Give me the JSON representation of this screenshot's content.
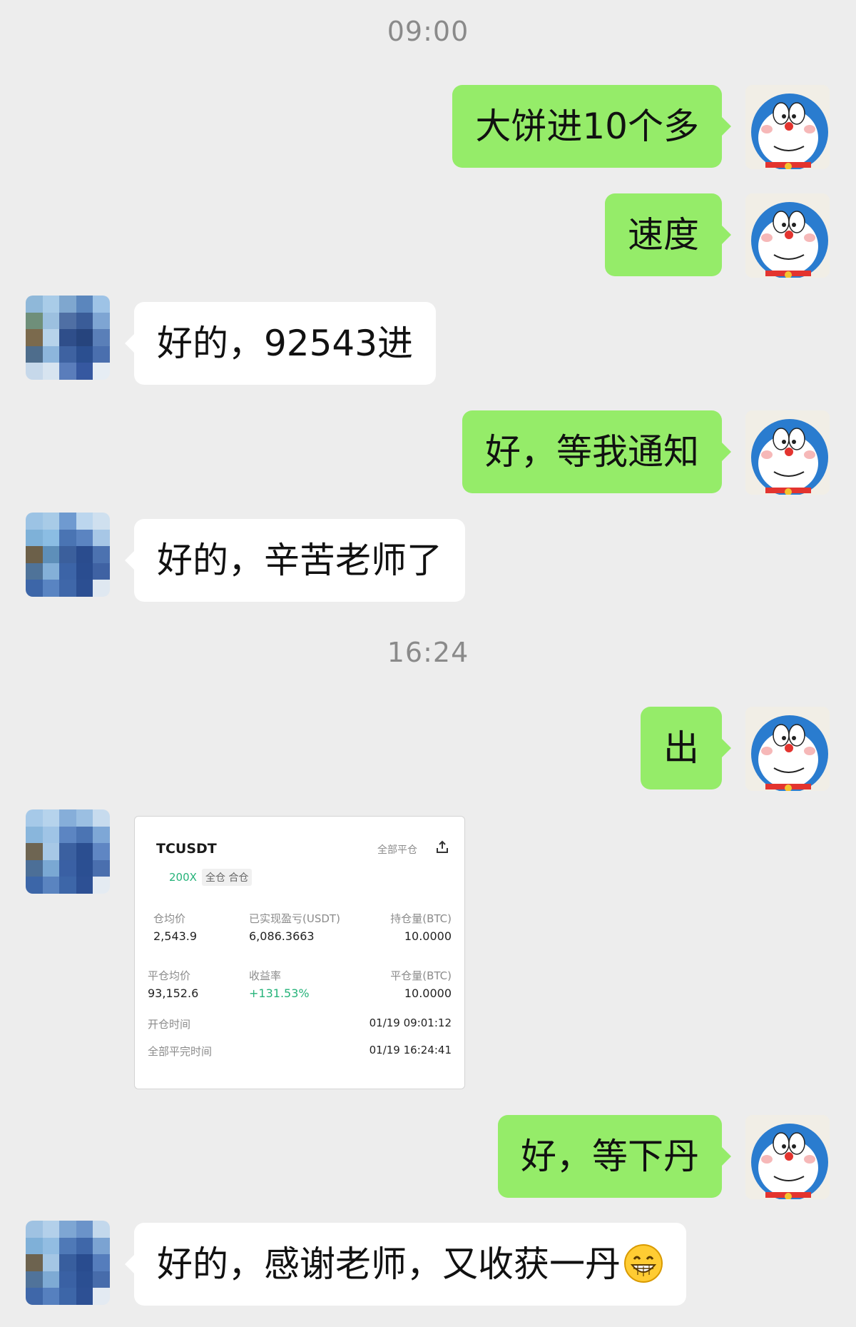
{
  "timestamps": [
    "09:00",
    "16:24"
  ],
  "messages": [
    {
      "side": "me",
      "text": "大饼进10个多"
    },
    {
      "side": "me",
      "text": "速度"
    },
    {
      "side": "peer",
      "text": "好的，92543进"
    },
    {
      "side": "me",
      "text": "好，等我通知"
    },
    {
      "side": "peer",
      "text": "好的，辛苦老师了"
    },
    {
      "side": "me",
      "text": "出"
    },
    {
      "side": "me",
      "text": "好，等下丹"
    },
    {
      "side": "peer",
      "text": "好的，感谢老师，又收获一丹"
    }
  ],
  "emoji": {
    "name": "grinning-face-icon"
  },
  "trade_card": {
    "symbol": "TCUSDT",
    "leverage": "200X",
    "margin_mode": "全仓 合仓",
    "close_all": "全部平仓",
    "share_icon": "share-icon",
    "open_avg_label": "仓均价",
    "open_avg_value": "2,543.9",
    "realized_pnl_label": "已实现盈亏(USDT)",
    "realized_pnl_value": "6,086.3663",
    "position_label": "持仓量(BTC)",
    "position_value": "10.0000",
    "close_avg_label": "平仓均价",
    "close_avg_value": "93,152.6",
    "yield_label": "收益率",
    "yield_value": "+131.53%",
    "closed_qty_label": "平仓量(BTC)",
    "closed_qty_value": "10.0000",
    "open_time_label": "开仓时间",
    "open_time_value": "01/19 09:01:12",
    "close_time_label": "全部平完时间",
    "close_time_value": "01/19 16:24:41"
  },
  "colors": {
    "background": "#ededed",
    "my_bubble": "#95ec69",
    "peer_bubble": "#ffffff",
    "timestamp": "#8a8a8a",
    "positive": "#26b37a"
  }
}
